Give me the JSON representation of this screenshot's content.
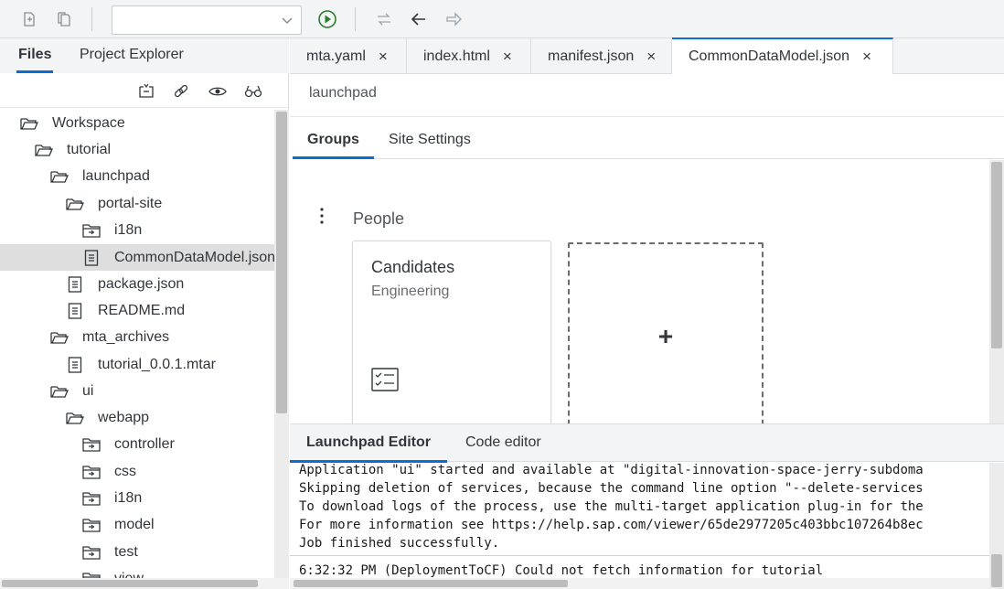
{
  "toolbar": {
    "buttons": [
      "new-file-icon",
      "copy-icon",
      "run-icon",
      "sync-icon",
      "back-icon",
      "forward-icon"
    ],
    "run_color": "#2b7d2b",
    "selector_value": ""
  },
  "left_panel": {
    "tabs": [
      {
        "label": "Files",
        "active": true
      },
      {
        "label": "Project Explorer",
        "active": false
      }
    ],
    "tools": [
      "collapse-all-icon",
      "link-icon",
      "show-hidden-icon",
      "search-icon"
    ],
    "tree": [
      {
        "label": "Workspace",
        "type": "folder-open",
        "selected": false
      },
      {
        "label": "tutorial",
        "type": "folder-open",
        "selected": false
      },
      {
        "label": "launchpad",
        "type": "folder-open",
        "selected": false
      },
      {
        "label": "portal-site",
        "type": "folder-open",
        "selected": false
      },
      {
        "label": "i18n",
        "type": "folder-closed",
        "selected": false
      },
      {
        "label": "CommonDataModel.json",
        "type": "file",
        "selected": true
      },
      {
        "label": "package.json",
        "type": "file",
        "selected": false
      },
      {
        "label": "README.md",
        "type": "file",
        "selected": false
      },
      {
        "label": "mta_archives",
        "type": "folder-open",
        "selected": false
      },
      {
        "label": "tutorial_0.0.1.mtar",
        "type": "file",
        "selected": false
      },
      {
        "label": "ui",
        "type": "folder-open",
        "selected": false
      },
      {
        "label": "webapp",
        "type": "folder-open",
        "selected": false
      },
      {
        "label": "controller",
        "type": "folder-closed",
        "selected": false
      },
      {
        "label": "css",
        "type": "folder-closed",
        "selected": false
      },
      {
        "label": "i18n",
        "type": "folder-closed",
        "selected": false
      },
      {
        "label": "model",
        "type": "folder-closed",
        "selected": false
      },
      {
        "label": "test",
        "type": "folder-closed",
        "selected": false
      },
      {
        "label": "view",
        "type": "folder-closed",
        "selected": false
      }
    ]
  },
  "editor": {
    "tabs": [
      {
        "label": "mta.yaml",
        "active": false
      },
      {
        "label": "index.html",
        "active": false
      },
      {
        "label": "manifest.json",
        "active": false
      },
      {
        "label": "CommonDataModel.json",
        "active": true
      }
    ],
    "close_glyph": "×",
    "breadcrumb": "launchpad",
    "sub_tabs": [
      {
        "label": "Groups",
        "active": true
      },
      {
        "label": "Site Settings",
        "active": false
      }
    ],
    "group": {
      "title": "People",
      "tile": {
        "title": "Candidates",
        "subtitle": "Engineering",
        "icon": "task-list-icon"
      },
      "add_label": "+"
    },
    "bottom_tabs": [
      {
        "label": "Launchpad Editor",
        "active": true
      },
      {
        "label": "Code editor",
        "active": false
      }
    ]
  },
  "console": {
    "lines": [
      "Application \"ui\" started and available at \"digital-innovation-space-jerry-subdoma",
      "Skipping deletion of services, because the command line option \"--delete-services",
      "To download logs of the process, use the multi-target application plug-in for the",
      "For more information see https://help.sap.com/viewer/65de2977205c403bbc107264b8ec",
      "Job finished successfully."
    ],
    "status_line": "6:32:32 PM (DeploymentToCF) Could not fetch information for tutorial"
  },
  "colors": {
    "accent": "#0a6ed1",
    "toolbar_bg": "#f2f4f6",
    "selected_row": "#dedede"
  }
}
